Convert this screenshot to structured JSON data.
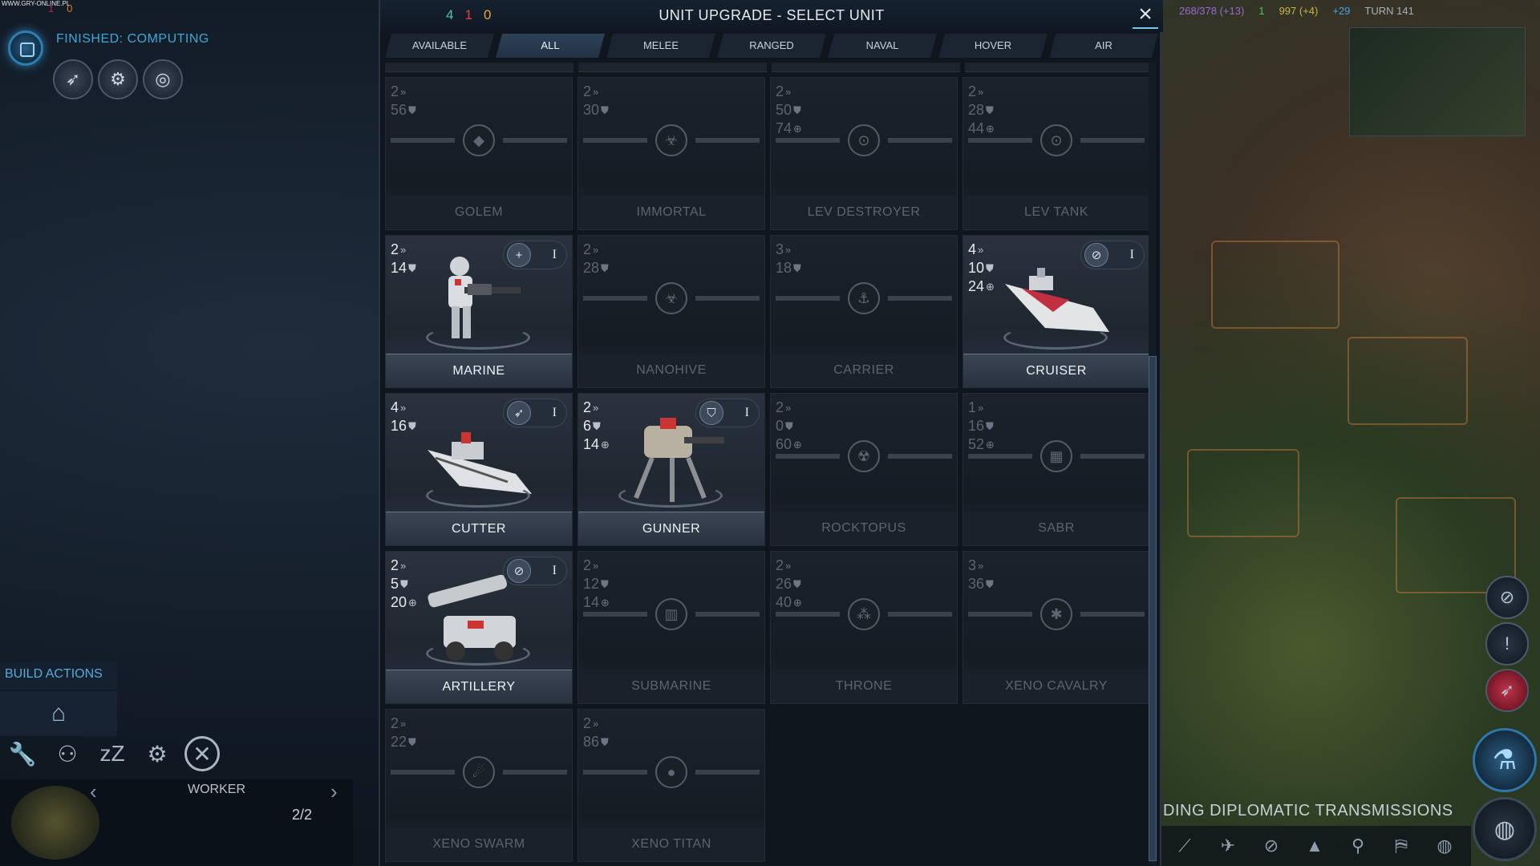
{
  "credit": "WWW.GRY-ONLINE.PL",
  "top_left": {
    "counters": [
      "1",
      "0"
    ],
    "computing_text": "FINISHED: COMPUTING",
    "icons": [
      "rocket-icon",
      "orbital-icon",
      "satellite-icon"
    ]
  },
  "build_actions": {
    "title": "BUILD ACTIONS",
    "worker_name": "WORKER",
    "worker_count": "2/2",
    "tools": [
      "wrench-icon",
      "person-icon",
      "sleep-icon",
      "gear-icon",
      "cancel-icon"
    ]
  },
  "top_right": {
    "population": "268/378 (+13)",
    "health": "1",
    "energy": "997 (+4)",
    "science": "+29",
    "turn": "TURN 141"
  },
  "dialog": {
    "title": "UNIT UPGRADE - SELECT UNIT",
    "counters": {
      "green": "4",
      "red": "1",
      "yellow": "0"
    },
    "tabs": [
      "AVAILABLE",
      "ALL",
      "MELEE",
      "RANGED",
      "NAVAL",
      "HOVER",
      "AIR"
    ],
    "active_tab": "ALL"
  },
  "units": [
    {
      "name": "GOLEM",
      "move": "2",
      "strength": "56",
      "ranged": null,
      "enabled": false,
      "tier": null,
      "affinity_icon": "purity-icon"
    },
    {
      "name": "IMMORTAL",
      "move": "2",
      "strength": "30",
      "ranged": null,
      "enabled": false,
      "tier": null,
      "affinity_icon": "harmony-icon"
    },
    {
      "name": "LEV DESTROYER",
      "move": "2",
      "strength": "50",
      "ranged": "74",
      "enabled": false,
      "tier": null,
      "affinity_icon": "supremacy-icon"
    },
    {
      "name": "LEV TANK",
      "move": "2",
      "strength": "28",
      "ranged": "44",
      "enabled": false,
      "tier": null,
      "affinity_icon": "supremacy-icon"
    },
    {
      "name": "MARINE",
      "move": "2",
      "strength": "14",
      "ranged": null,
      "enabled": true,
      "tier": "I",
      "affinity_icon": "plus-icon"
    },
    {
      "name": "NANOHIVE",
      "move": "2",
      "strength": "28",
      "ranged": null,
      "enabled": false,
      "tier": null,
      "affinity_icon": "harmony-icon"
    },
    {
      "name": "CARRIER",
      "move": "3",
      "strength": "18",
      "ranged": null,
      "enabled": false,
      "tier": null,
      "affinity_icon": "naval-icon"
    },
    {
      "name": "CRUISER",
      "move": "4",
      "strength": "10",
      "ranged": "24",
      "enabled": true,
      "tier": "I",
      "affinity_icon": "slash-icon"
    },
    {
      "name": "CUTTER",
      "move": "4",
      "strength": "16",
      "ranged": null,
      "enabled": true,
      "tier": "I",
      "affinity_icon": "feather-icon"
    },
    {
      "name": "GUNNER",
      "move": "2",
      "strength": "6",
      "ranged": "14",
      "enabled": true,
      "tier": "I",
      "affinity_icon": "shield-icon"
    },
    {
      "name": "ROCKTOPUS",
      "move": "2",
      "strength": "0",
      "ranged": "60",
      "enabled": false,
      "tier": null,
      "affinity_icon": "radiation-icon"
    },
    {
      "name": "SABR",
      "move": "1",
      "strength": "16",
      "ranged": "52",
      "enabled": false,
      "tier": null,
      "affinity_icon": "mesh-icon"
    },
    {
      "name": "ARTILLERY",
      "move": "2",
      "strength": "5",
      "ranged": "20",
      "enabled": true,
      "tier": "I",
      "affinity_icon": "slash-icon"
    },
    {
      "name": "SUBMARINE",
      "move": "2",
      "strength": "12",
      "ranged": "14",
      "enabled": false,
      "tier": null,
      "affinity_icon": "sub-icon"
    },
    {
      "name": "THRONE",
      "move": "2",
      "strength": "26",
      "ranged": "40",
      "enabled": false,
      "tier": null,
      "affinity_icon": "dots-icon"
    },
    {
      "name": "XENO CAVALRY",
      "move": "3",
      "strength": "36",
      "ranged": null,
      "enabled": false,
      "tier": null,
      "affinity_icon": "alien-icon"
    },
    {
      "name": "XENO SWARM",
      "move": "2",
      "strength": "22",
      "ranged": null,
      "enabled": false,
      "tier": null,
      "affinity_icon": "swarm-icon"
    },
    {
      "name": "XENO TITAN",
      "move": "2",
      "strength": "86",
      "ranged": null,
      "enabled": false,
      "tier": null,
      "affinity_icon": "titan-icon"
    }
  ],
  "right_side": {
    "diplomacy_text": "IDING DIPLOMATIC TRANSMISSIONS"
  }
}
